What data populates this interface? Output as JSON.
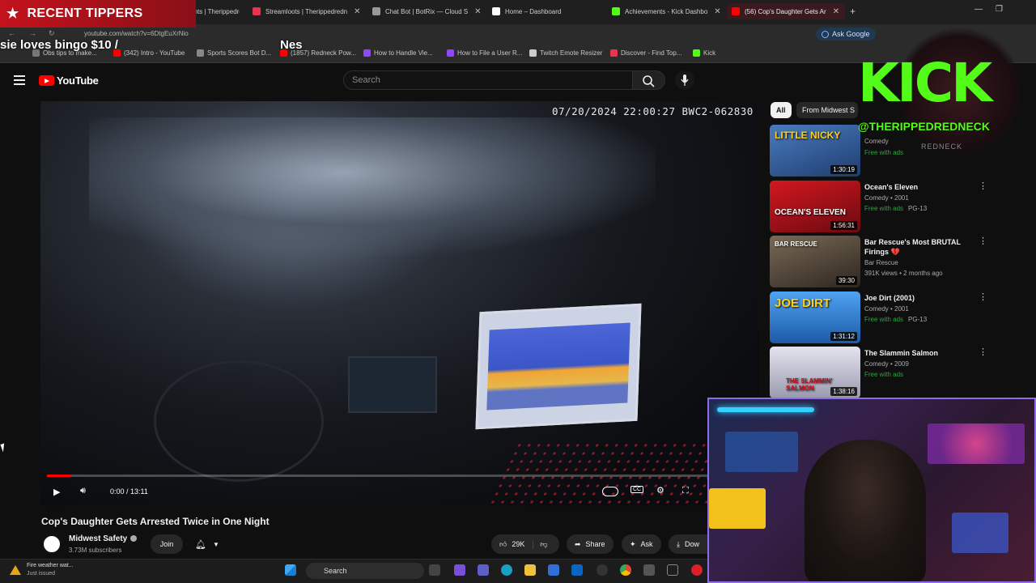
{
  "overlay": {
    "tippers_title": "RECENT TIPPERS",
    "ticker_left": "sie loves bingo $10 /",
    "ticker_right": "Nes",
    "kick_logo": "KICK",
    "kick_handle": "@THERIPPEDREDNECK",
    "kick_sub": "REDNECK"
  },
  "browser": {
    "tabs": [
      {
        "title": "Streamelements | Therippedred",
        "color": "#8a3ab9"
      },
      {
        "title": "Streamloots | Therippedredn",
        "color": "#e8344e"
      },
      {
        "title": "Chat Bot | BotRix — Cloud S",
        "color": "#999999"
      },
      {
        "title": "Home – Dashboard",
        "color": "#ffffff"
      },
      {
        "title": "Achievements - Kick Dashbo",
        "color": "#53fc18"
      },
      {
        "title": "(56) Cop's Daughter Gets Ar",
        "color": "#ff0000"
      }
    ],
    "url": "youtube.com/watch?v=6DtgEuXrNio",
    "ask_google": "Ask Google",
    "bookmarks": [
      {
        "label": "Obs tips to make...",
        "color": "#777777"
      },
      {
        "label": "(342) Intro - YouTube",
        "color": "#ff0000"
      },
      {
        "label": "Sports Scores Bot D...",
        "color": "#888888"
      },
      {
        "label": "(1857) Redneck Pow...",
        "color": "#ff0000"
      },
      {
        "label": "How to Handle Vie...",
        "color": "#9146ff"
      },
      {
        "label": "How to File a User R...",
        "color": "#9146ff"
      },
      {
        "label": "Twitch Emote Resizer",
        "color": "#cccccc"
      },
      {
        "label": "Discover - Find Top...",
        "color": "#e8344e"
      },
      {
        "label": "Kick",
        "color": "#53fc18"
      }
    ]
  },
  "youtube": {
    "logo": "YouTube",
    "search_placeholder": "Search",
    "video": {
      "timestamp": "07/20/2024 22:00:27  BWC2-062830",
      "time_display": "0:00 / 13:11",
      "progress_fraction": 0.035
    },
    "title": "Cop's Daughter Gets Arrested Twice in One Night",
    "channel": {
      "name": "Midwest Safety",
      "subscribers": "3.73M subscribers",
      "join_label": "Join"
    },
    "actions": {
      "likes": "29K",
      "share": "Share",
      "ask": "Ask",
      "download": "Dow"
    },
    "chips": [
      "All",
      "From Midwest S"
    ],
    "recommendations": [
      {
        "thumb_text": "LITTLE NICKY",
        "title": "",
        "meta": "Comedy",
        "free": "Free with ads",
        "rating": "",
        "duration": "1:30:19",
        "thumb_color": "#3d6aa5"
      },
      {
        "thumb_text": "OCEAN'S ELEVEN",
        "title": "Ocean's Eleven",
        "meta": "Comedy • 2001",
        "free": "Free with ads",
        "rating": "PG-13",
        "duration": "1:56:31",
        "thumb_color": "#b0121c"
      },
      {
        "thumb_text": "BAR RESCUE",
        "title": "Bar Rescue's Most BRUTAL Firings 💔",
        "meta": "Bar Rescue",
        "meta2": "391K views • 2 months ago",
        "free": "",
        "rating": "",
        "duration": "39:30",
        "thumb_color": "#5a4a3a"
      },
      {
        "thumb_text": "JOE DIRT",
        "title": "Joe Dirt (2001)",
        "meta": "Comedy • 2001",
        "free": "Free with ads",
        "rating": "PG-13",
        "duration": "1:31:12",
        "thumb_color": "#2e7bd6"
      },
      {
        "thumb_text": "THE SLAMMIN' SALMON",
        "title": "The Slammin Salmon",
        "meta": "Comedy • 2009",
        "free": "Free with ads",
        "rating": "",
        "duration": "1:38:16",
        "thumb_color": "#c8c8d8"
      }
    ]
  },
  "taskbar": {
    "notif_title": "Fire weather wat...",
    "notif_sub": "Just issued",
    "search": "Search"
  }
}
